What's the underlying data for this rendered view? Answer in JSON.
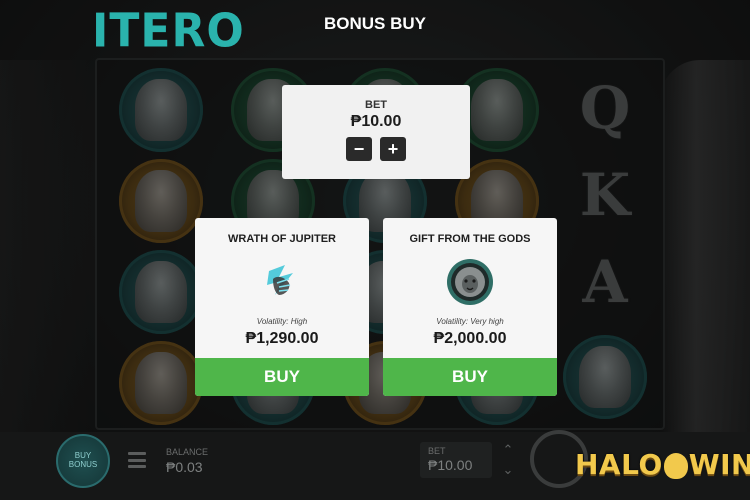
{
  "game": {
    "logo": "ITERO",
    "screen_title": "BONUS BUY",
    "reel_letters": [
      "Q",
      "K",
      "A"
    ]
  },
  "bet_panel": {
    "label": "BET",
    "value": "₱10.00",
    "decrease_label": "−",
    "increase_label": "+"
  },
  "offers": [
    {
      "title": "WRATH OF JUPITER",
      "icon": "lightning-hand-icon",
      "volatility": "Volatility: High",
      "price": "₱1,290.00",
      "buy_label": "BUY"
    },
    {
      "title": "GIFT FROM THE GODS",
      "icon": "lion-medallion-icon",
      "volatility": "Volatility: Very high",
      "price": "₱2,000.00",
      "buy_label": "BUY"
    }
  ],
  "bottom_bar": {
    "buy_bonus_line1": "BUY",
    "buy_bonus_line2": "BONUS",
    "balance_label": "BALANCE",
    "balance_value": "₱0.03",
    "bet_label": "BET",
    "bet_value": "₱10.00"
  },
  "watermark": {
    "left": "HALO",
    "right": "WIN"
  },
  "colors": {
    "accent_teal": "#2ab3ad",
    "buy_green": "#4fb64a",
    "panel_bg": "#f6f6f6",
    "watermark_gold": "#f2c94c"
  }
}
